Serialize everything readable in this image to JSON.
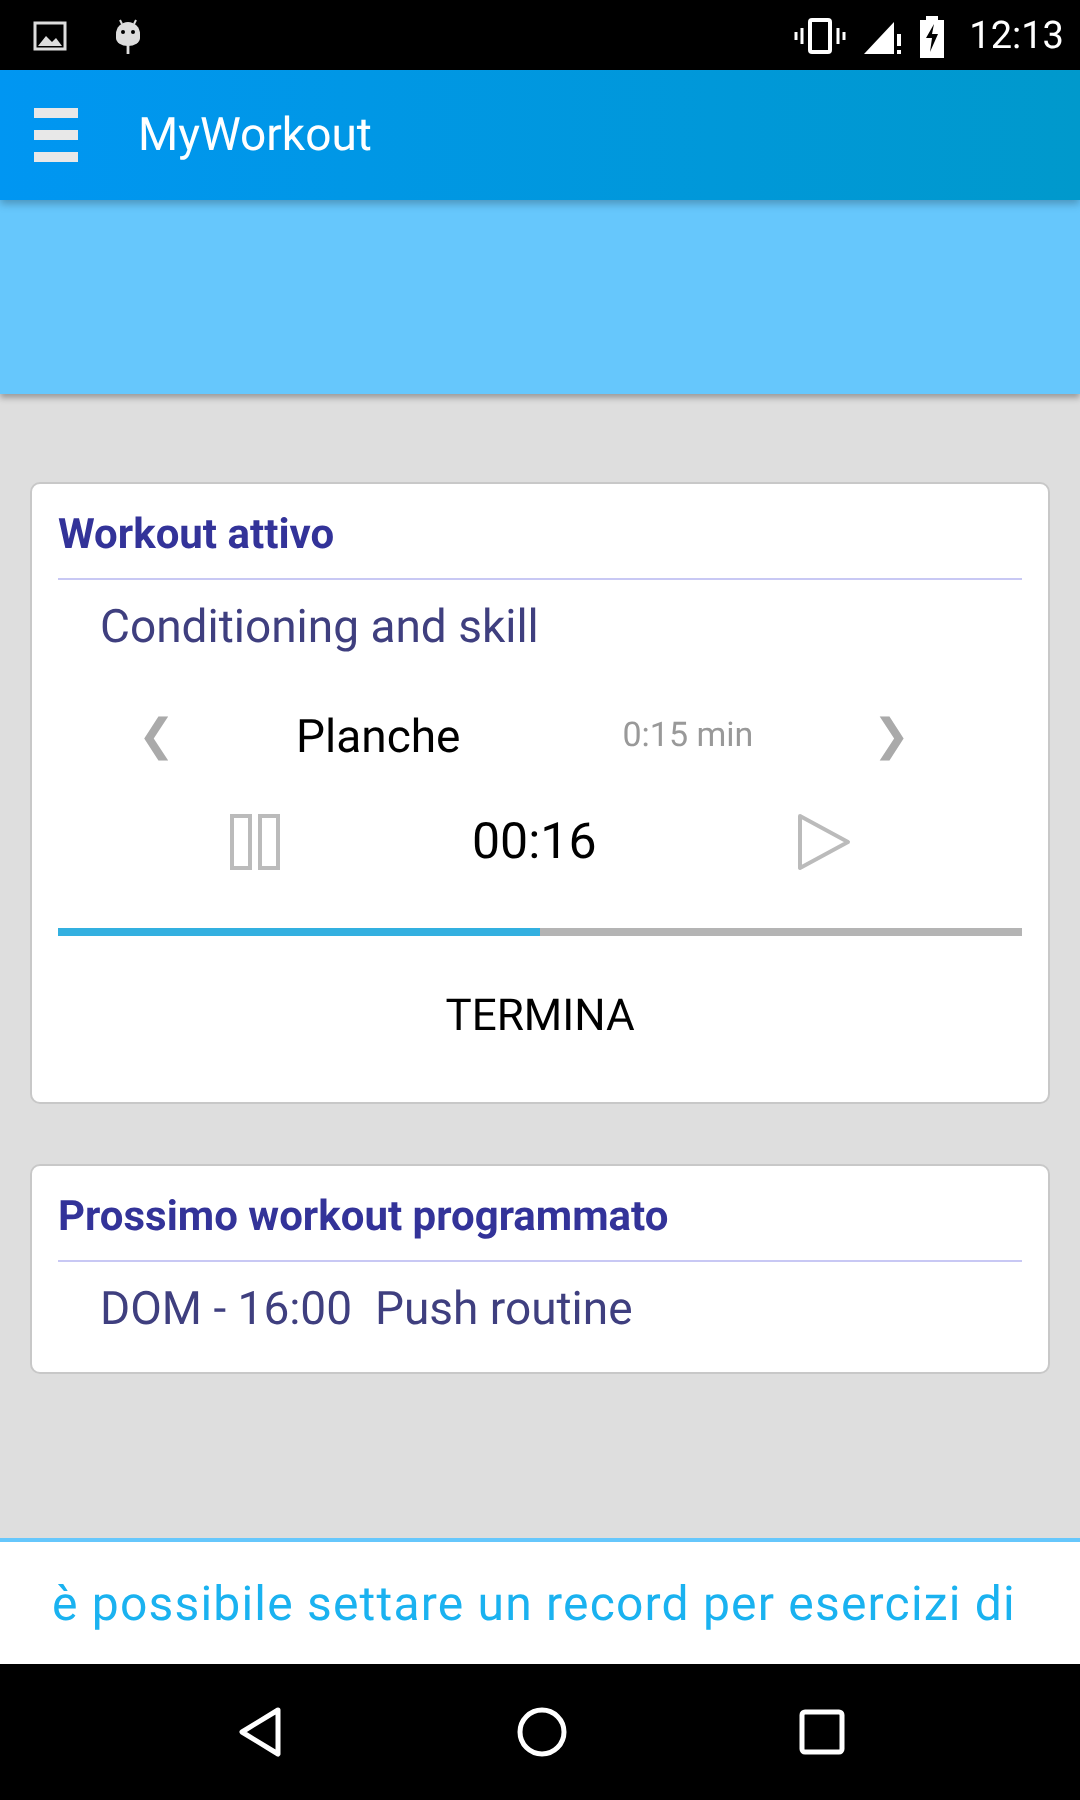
{
  "status_bar": {
    "time": "12:13"
  },
  "app_bar": {
    "title": "MyWorkout"
  },
  "active_workout": {
    "title": "Workout attivo",
    "name": "Conditioning and skill",
    "exercise": "Planche",
    "duration": "0:15 min",
    "prev": "❮",
    "next": "❯",
    "timer": "00:16",
    "level": 0.5,
    "end_button": "TERMINA"
  },
  "next_workout": {
    "title": "Prossimo workout programmato",
    "entry": "DOM - 16:00  Push routine"
  },
  "ticker": {
    "text": "è possibile settare un record per esercizi di"
  }
}
